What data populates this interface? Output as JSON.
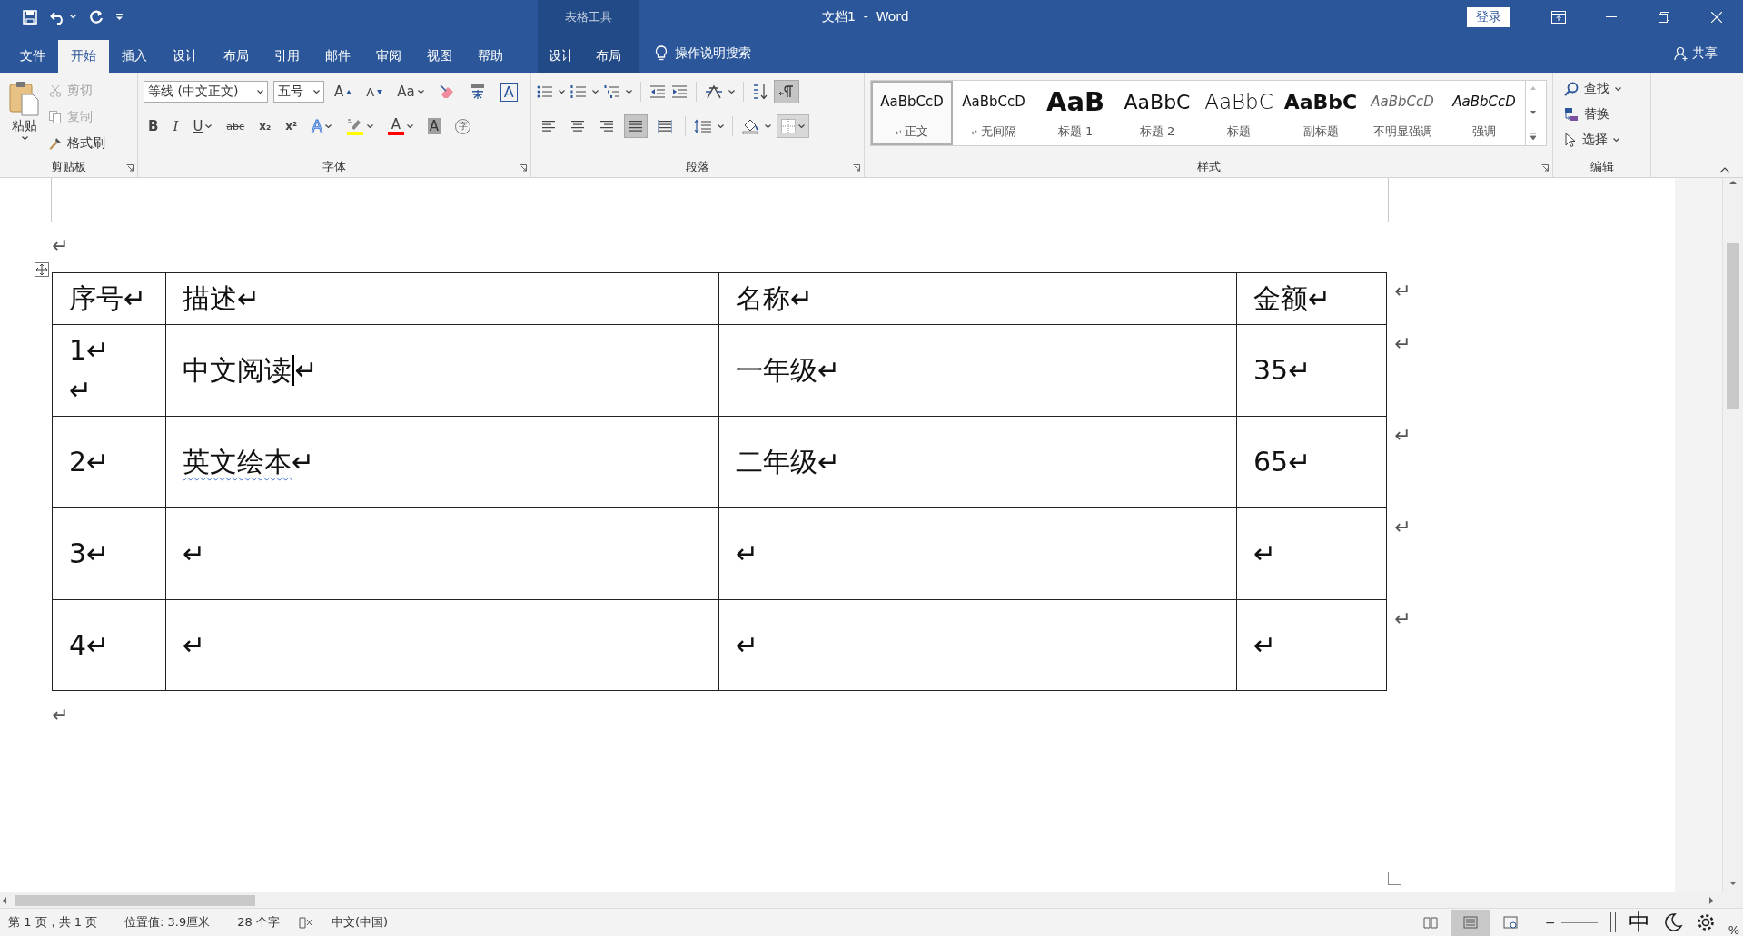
{
  "title_bar": {
    "context_label": "表格工具",
    "title": "文档1  -  Word",
    "login_button": "登录"
  },
  "ribbon_tabs": [
    {
      "label": "文件",
      "selected": false,
      "kind": "file"
    },
    {
      "label": "开始",
      "selected": true,
      "kind": "main"
    },
    {
      "label": "插入",
      "selected": false,
      "kind": "main"
    },
    {
      "label": "设计",
      "selected": false,
      "kind": "main"
    },
    {
      "label": "布局",
      "selected": false,
      "kind": "main"
    },
    {
      "label": "引用",
      "selected": false,
      "kind": "main"
    },
    {
      "label": "邮件",
      "selected": false,
      "kind": "main"
    },
    {
      "label": "审阅",
      "selected": false,
      "kind": "main"
    },
    {
      "label": "视图",
      "selected": false,
      "kind": "main"
    },
    {
      "label": "帮助",
      "selected": false,
      "kind": "main"
    },
    {
      "label": "设计",
      "selected": false,
      "kind": "contextual"
    },
    {
      "label": "布局",
      "selected": false,
      "kind": "contextual"
    }
  ],
  "tell_me": "操作说明搜索",
  "share": "共享",
  "clipboard": {
    "paste": "粘贴",
    "items": [
      {
        "kind": "cut",
        "label": "剪切",
        "disabled": true
      },
      {
        "kind": "copy",
        "label": "复制",
        "disabled": true
      },
      {
        "kind": "painter",
        "label": "格式刷",
        "disabled": false
      }
    ],
    "group_label": "剪贴板"
  },
  "font": {
    "font_name": "等线 (中文正文)",
    "font_size": "五号",
    "row1": [
      {
        "kind": "grow",
        "text": "A"
      },
      {
        "kind": "shrink",
        "text": "A"
      },
      {
        "kind": "case",
        "text": "Aa"
      },
      {
        "kind": "clear"
      },
      {
        "kind": "phonetic"
      },
      {
        "kind": "border",
        "text": "A"
      }
    ],
    "row2": [
      {
        "kind": "bold",
        "text": "B"
      },
      {
        "kind": "italic",
        "text": "I"
      },
      {
        "kind": "underline",
        "text": "U"
      },
      {
        "kind": "strike",
        "text": "abc"
      },
      {
        "kind": "subscript",
        "text": "x₂"
      },
      {
        "kind": "superscript",
        "text": "x²"
      },
      {
        "kind": "effects",
        "text": "A"
      },
      {
        "kind": "highlight",
        "color": "#ffff00"
      },
      {
        "kind": "color",
        "text": "A",
        "color": "#ff0000"
      },
      {
        "kind": "shading",
        "text": "A"
      },
      {
        "kind": "enclose",
        "text": "字"
      }
    ],
    "group_label": "字体"
  },
  "paragraph": {
    "show_marks": true,
    "alignments": [
      {
        "kind": "left",
        "selected": false
      },
      {
        "kind": "center",
        "selected": false
      },
      {
        "kind": "right",
        "selected": false
      },
      {
        "kind": "justify",
        "selected": true
      },
      {
        "kind": "distributed",
        "selected": false
      }
    ],
    "group_label": "段落"
  },
  "styles": {
    "items": [
      {
        "kind": "normal",
        "preview": "AaBbCcD",
        "label": "正文",
        "selected": true,
        "mark": "↵"
      },
      {
        "kind": "normal",
        "preview": "AaBbCcD",
        "label": "无间隔",
        "selected": false,
        "mark": "↵"
      },
      {
        "kind": "heading1",
        "preview": "AaB",
        "label": "标题 1",
        "selected": false
      },
      {
        "kind": "heading2",
        "preview": "AaBbC",
        "label": "标题 2",
        "selected": false
      },
      {
        "kind": "title",
        "preview": "AaBbC",
        "label": "标题",
        "selected": false
      },
      {
        "kind": "subtitle",
        "preview": "AaBbC",
        "label": "副标题",
        "selected": false
      },
      {
        "kind": "subtle",
        "preview": "AaBbCcD",
        "label": "不明显强调",
        "selected": false
      },
      {
        "kind": "emphasis",
        "preview": "AaBbCcD",
        "label": "强调",
        "selected": false
      }
    ],
    "group_label": "样式"
  },
  "editing": {
    "items": [
      {
        "kind": "find",
        "label": "查找"
      },
      {
        "kind": "replace",
        "label": "替换"
      },
      {
        "kind": "select",
        "label": "选择"
      }
    ],
    "group_label": "编辑"
  },
  "document": {
    "before_mark": "↵",
    "after_mark": "↵",
    "table": {
      "header": {
        "cells": [
          {
            "text": "序号↵",
            "flagged": false
          },
          {
            "text": "描述↵",
            "flagged": false
          },
          {
            "text": "名称↵",
            "flagged": false
          },
          {
            "text": "金额↵",
            "flagged": false
          }
        ],
        "end_mark": "↵"
      },
      "rows": [
        {
          "cells": [
            {
              "text": "1↵\n↵",
              "flagged": false
            },
            {
              "text": "中文阅读",
              "flagged": false,
              "caret": true,
              "mark": "↵"
            },
            {
              "text": "一年级↵",
              "flagged": false
            },
            {
              "text": "35↵",
              "flagged": false
            }
          ],
          "end_mark": "↵"
        },
        {
          "cells": [
            {
              "text": "2↵",
              "flagged": false
            },
            {
              "text": "英文绘本",
              "flagged": true,
              "mark": "↵"
            },
            {
              "text": "二年级↵",
              "flagged": false
            },
            {
              "text": "65↵",
              "flagged": false
            }
          ],
          "end_mark": "↵"
        },
        {
          "cells": [
            {
              "text": "3↵",
              "flagged": false
            },
            {
              "text": "↵",
              "flagged": false
            },
            {
              "text": "↵",
              "flagged": false
            },
            {
              "text": "↵",
              "flagged": false
            }
          ],
          "end_mark": "↵"
        },
        {
          "cells": [
            {
              "text": "4↵",
              "flagged": false
            },
            {
              "text": "↵",
              "flagged": false
            },
            {
              "text": "↵",
              "flagged": false
            },
            {
              "text": "↵",
              "flagged": false
            }
          ],
          "end_mark": "↵"
        }
      ]
    }
  },
  "status_bar": {
    "items": [
      "第 1 页，共 1 页",
      "位置值: 3.9厘米",
      "28 个字"
    ],
    "language": "中文(中国)",
    "view_modes": [
      {
        "kind": "read",
        "selected": false
      },
      {
        "kind": "print",
        "selected": true
      },
      {
        "kind": "web",
        "selected": false
      }
    ],
    "zoom_minus": "−",
    "ime_mode": "中",
    "zoom_suffix": "%"
  }
}
